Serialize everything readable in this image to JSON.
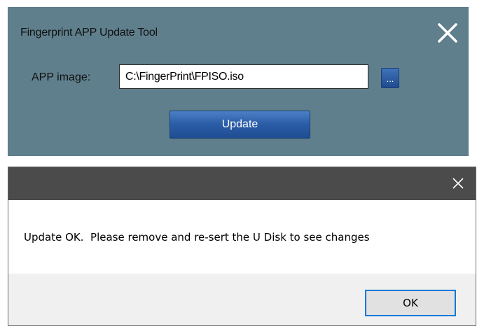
{
  "tool_window": {
    "title": "Fingerprint APP Update Tool",
    "close_glyph": "close-icon",
    "app_image_label": "APP image:",
    "app_image_value": "C:\\FingerPrint\\FPISO.iso",
    "browse_label": "...",
    "update_label": "Update",
    "background_color": "#5f7f8c",
    "button_color": "#2a5ca6"
  },
  "dialog": {
    "titlebar_color": "#4b4b4b",
    "close_glyph": "close-icon",
    "message": "Update OK.  Please remove and re-sert the U Disk to see changes",
    "ok_label": "OK",
    "focus_color": "#0078d7"
  }
}
